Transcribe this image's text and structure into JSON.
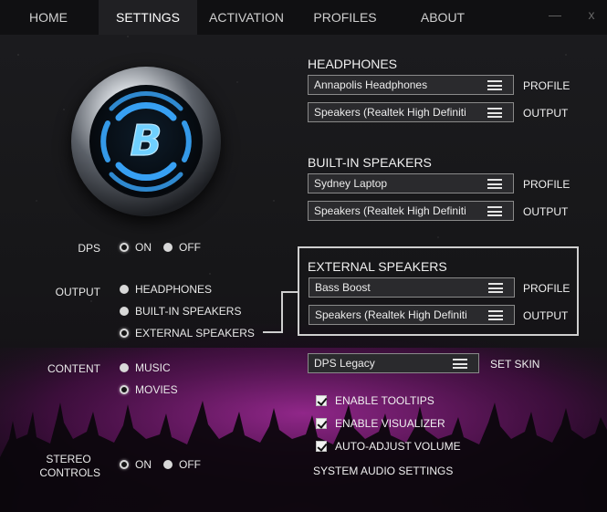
{
  "nav": {
    "tabs": [
      {
        "label": "HOME"
      },
      {
        "label": "SETTINGS"
      },
      {
        "label": "ACTIVATION"
      },
      {
        "label": "PROFILES"
      },
      {
        "label": "ABOUT"
      }
    ],
    "active_tab": "SETTINGS",
    "minimize_glyph": "—",
    "close_glyph": "x"
  },
  "colors": {
    "accent_blue": "#3aa9ff",
    "crowd_magenta": "#7a1a72"
  },
  "logo": {
    "letter": "B",
    "icon": "b-logo-icon"
  },
  "left": {
    "dps": {
      "label": "DPS",
      "options": [
        "ON",
        "OFF"
      ],
      "selected": "ON"
    },
    "output": {
      "label": "OUTPUT",
      "options": [
        "HEADPHONES",
        "BUILT-IN SPEAKERS",
        "EXTERNAL SPEAKERS"
      ],
      "selected": "EXTERNAL SPEAKERS"
    },
    "content": {
      "label": "CONTENT",
      "options": [
        "MUSIC",
        "MOVIES"
      ],
      "selected": "MOVIES"
    },
    "stereo": {
      "label_line1": "STEREO",
      "label_line2": "CONTROLS",
      "options": [
        "ON",
        "OFF"
      ],
      "selected": "ON"
    }
  },
  "sections": {
    "headphones": {
      "title": "HEADPHONES",
      "profile": "Annapolis Headphones",
      "output": "Speakers (Realtek High Definiti"
    },
    "builtin": {
      "title": "BUILT-IN SPEAKERS",
      "profile": "Sydney Laptop",
      "output": "Speakers (Realtek High Definiti"
    },
    "external": {
      "title": "EXTERNAL SPEAKERS",
      "profile": "Bass Boost",
      "output": "Speakers (Realtek High Definiti"
    },
    "profile_label": "PROFILE",
    "output_label": "OUTPUT"
  },
  "skin": {
    "value": "DPS Legacy",
    "label": "SET SKIN"
  },
  "options": {
    "tooltips": "ENABLE TOOLTIPS",
    "visualizer": "ENABLE VISUALIZER",
    "autoadjust": "AUTO-ADJUST VOLUME",
    "system_link": "SYSTEM AUDIO SETTINGS"
  }
}
